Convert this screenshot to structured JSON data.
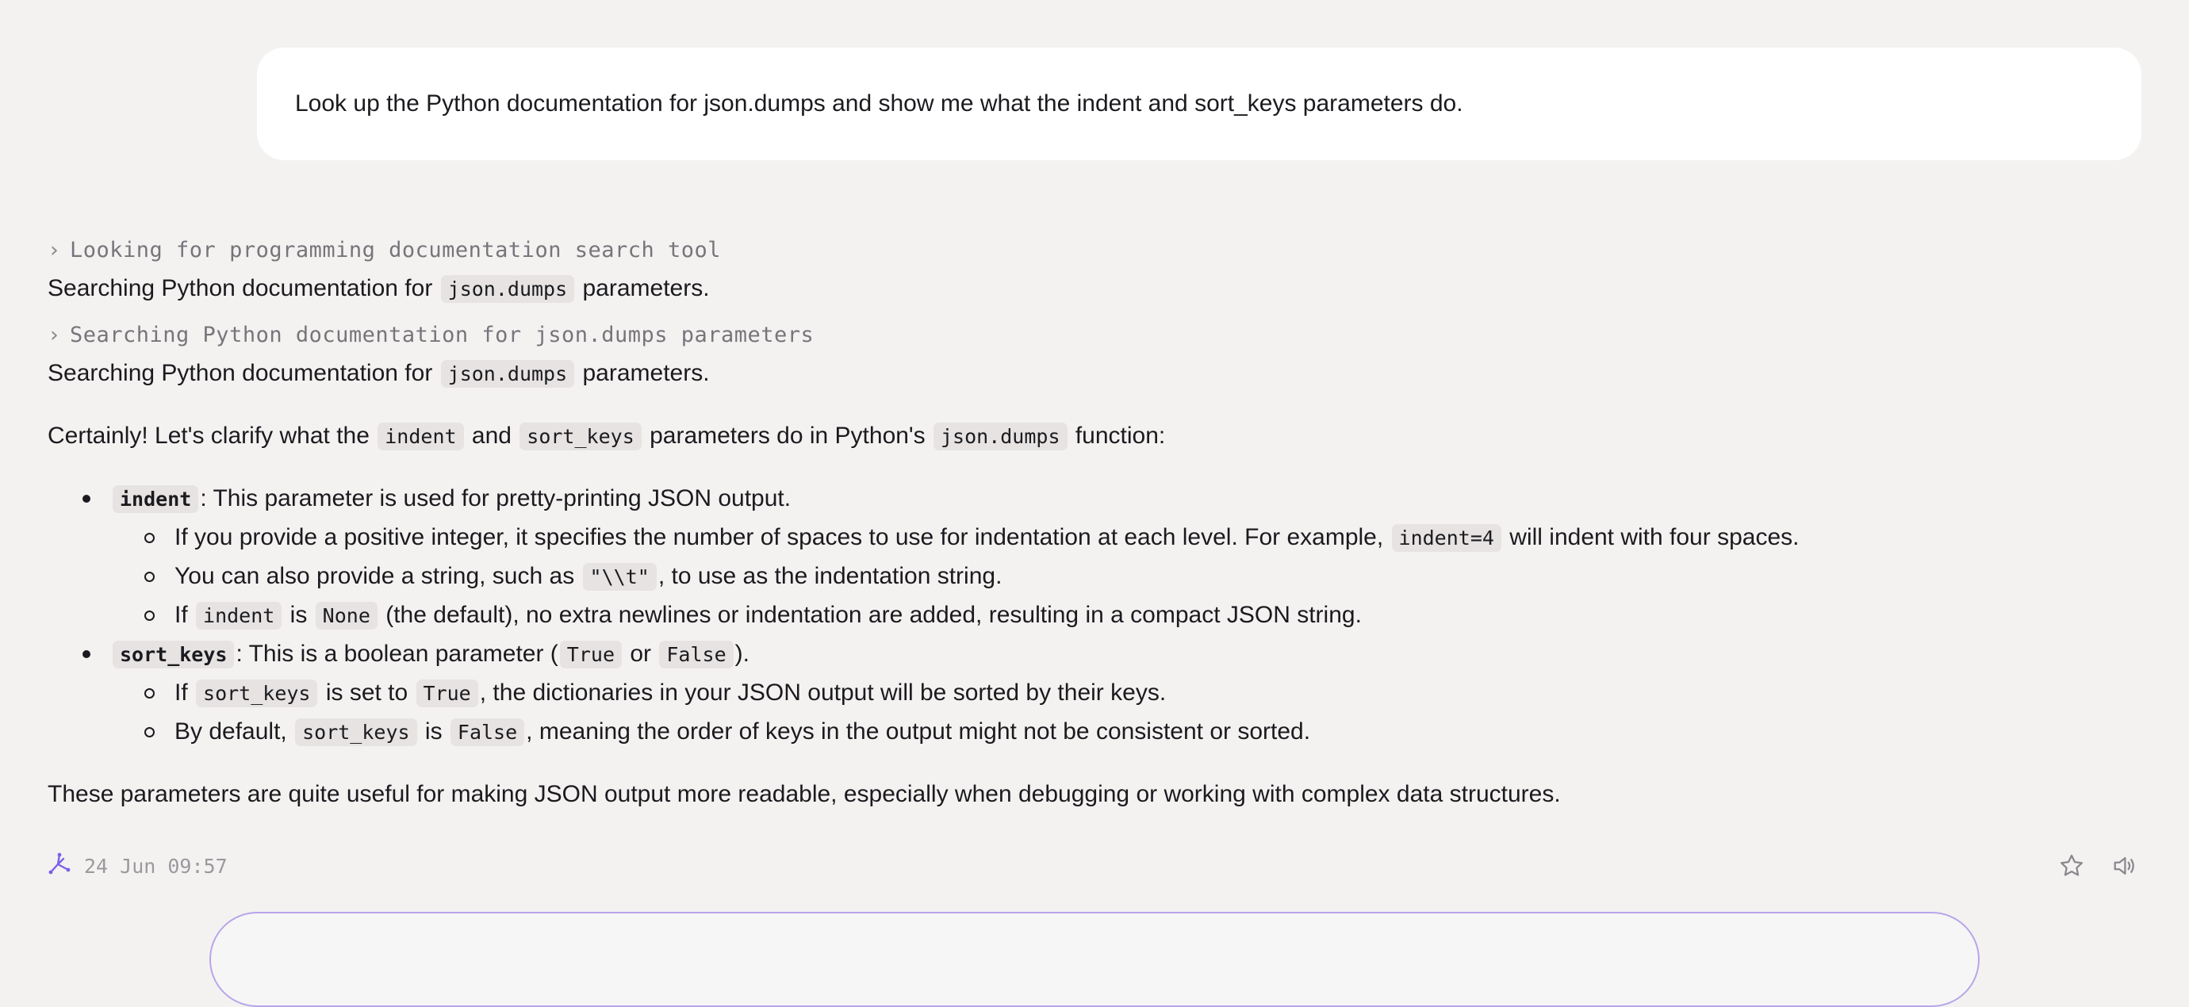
{
  "user_message": {
    "text": "Look up the Python documentation for json.dumps and show me what the indent and sort_keys parameters do."
  },
  "steps": [
    {
      "tool_label": "Looking for programming documentation search tool",
      "text_before": "Searching Python documentation for ",
      "code": "json.dumps",
      "text_after": " parameters."
    },
    {
      "tool_label": "Searching Python documentation for json.dumps parameters",
      "text_before": "Searching Python documentation for ",
      "code": "json.dumps",
      "text_after": " parameters."
    }
  ],
  "answer": {
    "intro": {
      "t1": "Certainly! Let's clarify what the ",
      "c1": "indent",
      "t2": " and ",
      "c2": "sort_keys",
      "t3": " parameters do in Python's ",
      "c3": "json.dumps",
      "t4": " function:"
    },
    "indent": {
      "name": "indent",
      "desc": ": This parameter is used for pretty-printing JSON output.",
      "sub1": {
        "t1": "If you provide a positive integer, it specifies the number of spaces to use for indentation at each level. For example, ",
        "c1": "indent=4",
        "t2": " will indent with four spaces."
      },
      "sub2": {
        "t1": "You can also provide a string, such as ",
        "c1": "\"\\\\t\"",
        "t2": ", to use as the indentation string."
      },
      "sub3": {
        "t1": "If ",
        "c1": "indent",
        "t2": " is ",
        "c2": "None",
        "t3": " (the default), no extra newlines or indentation are added, resulting in a compact JSON string."
      }
    },
    "sort_keys": {
      "name": "sort_keys",
      "t1": ": This is a boolean parameter (",
      "c1": "True",
      "t2": " or ",
      "c2": "False",
      "t3": ").",
      "sub1": {
        "t1": "If ",
        "c1": "sort_keys",
        "t2": " is set to ",
        "c2": "True",
        "t3": ", the dictionaries in your JSON output will be sorted by their keys."
      },
      "sub2": {
        "t1": "By default, ",
        "c1": "sort_keys",
        "t2": " is ",
        "c2": "False",
        "t3": ", meaning the order of keys in the output might not be consistent or sorted."
      }
    },
    "closing": "These parameters are quite useful for making JSON output more readable, especially when debugging or working with complex data structures."
  },
  "footer": {
    "timestamp": "24 Jun 09:57",
    "brand_icon": "assistant-logo-icon",
    "actions": [
      "star-icon",
      "speaker-icon"
    ]
  },
  "colors": {
    "background": "#f4f2f1",
    "bubble": "#ffffff",
    "code_bg": "#e6e3e2",
    "accent": "#7b61e8",
    "composer_border": "#b7a6ea"
  }
}
